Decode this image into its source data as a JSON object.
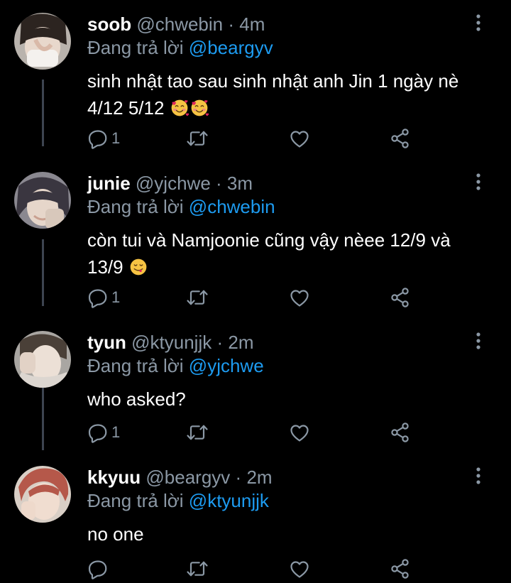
{
  "colors": {
    "background": "#000000",
    "text": "#ffffff",
    "muted": "#8b98a5",
    "mention": "#1d9bf0",
    "thread_line": "#3d4450"
  },
  "tweets": [
    {
      "name": "soob",
      "handle": "@chwebin",
      "separator": "·",
      "time": "4m",
      "reply_prefix": "Đang trả lời",
      "reply_to": "@beargyv",
      "text": "sinh nhật tao sau sinh nhật anh Jin 1 ngày nè 4/12 5/12",
      "emoji": [
        "smiling-face-with-hearts",
        "smiling-face-with-hearts"
      ],
      "reply_count": "1",
      "icons": [
        "reply-icon",
        "retweet-icon",
        "like-icon",
        "share-icon",
        "more-icon"
      ]
    },
    {
      "name": "junie",
      "handle": "@yjchwe",
      "separator": "·",
      "time": "3m",
      "reply_prefix": "Đang trả lời",
      "reply_to": "@chwebin",
      "text": "còn tui và Namjoonie cũng vậy nèee 12/9 và 13/9",
      "emoji": [
        "face-savoring-food"
      ],
      "reply_count": "1",
      "icons": [
        "reply-icon",
        "retweet-icon",
        "like-icon",
        "share-icon",
        "more-icon"
      ]
    },
    {
      "name": "tyun",
      "handle": "@ktyunjjk",
      "separator": "·",
      "time": "2m",
      "reply_prefix": "Đang trả lời",
      "reply_to": "@yjchwe",
      "text": "who asked?",
      "emoji": [],
      "reply_count": "1",
      "icons": [
        "reply-icon",
        "retweet-icon",
        "like-icon",
        "share-icon",
        "more-icon"
      ]
    },
    {
      "name": "kkyuu",
      "handle": "@beargyv",
      "separator": "·",
      "time": "2m",
      "reply_prefix": "Đang trả lời",
      "reply_to": "@ktyunjjk",
      "text": "no one",
      "emoji": [],
      "reply_count": "",
      "icons": [
        "reply-icon",
        "retweet-icon",
        "like-icon",
        "share-icon",
        "more-icon"
      ]
    }
  ]
}
